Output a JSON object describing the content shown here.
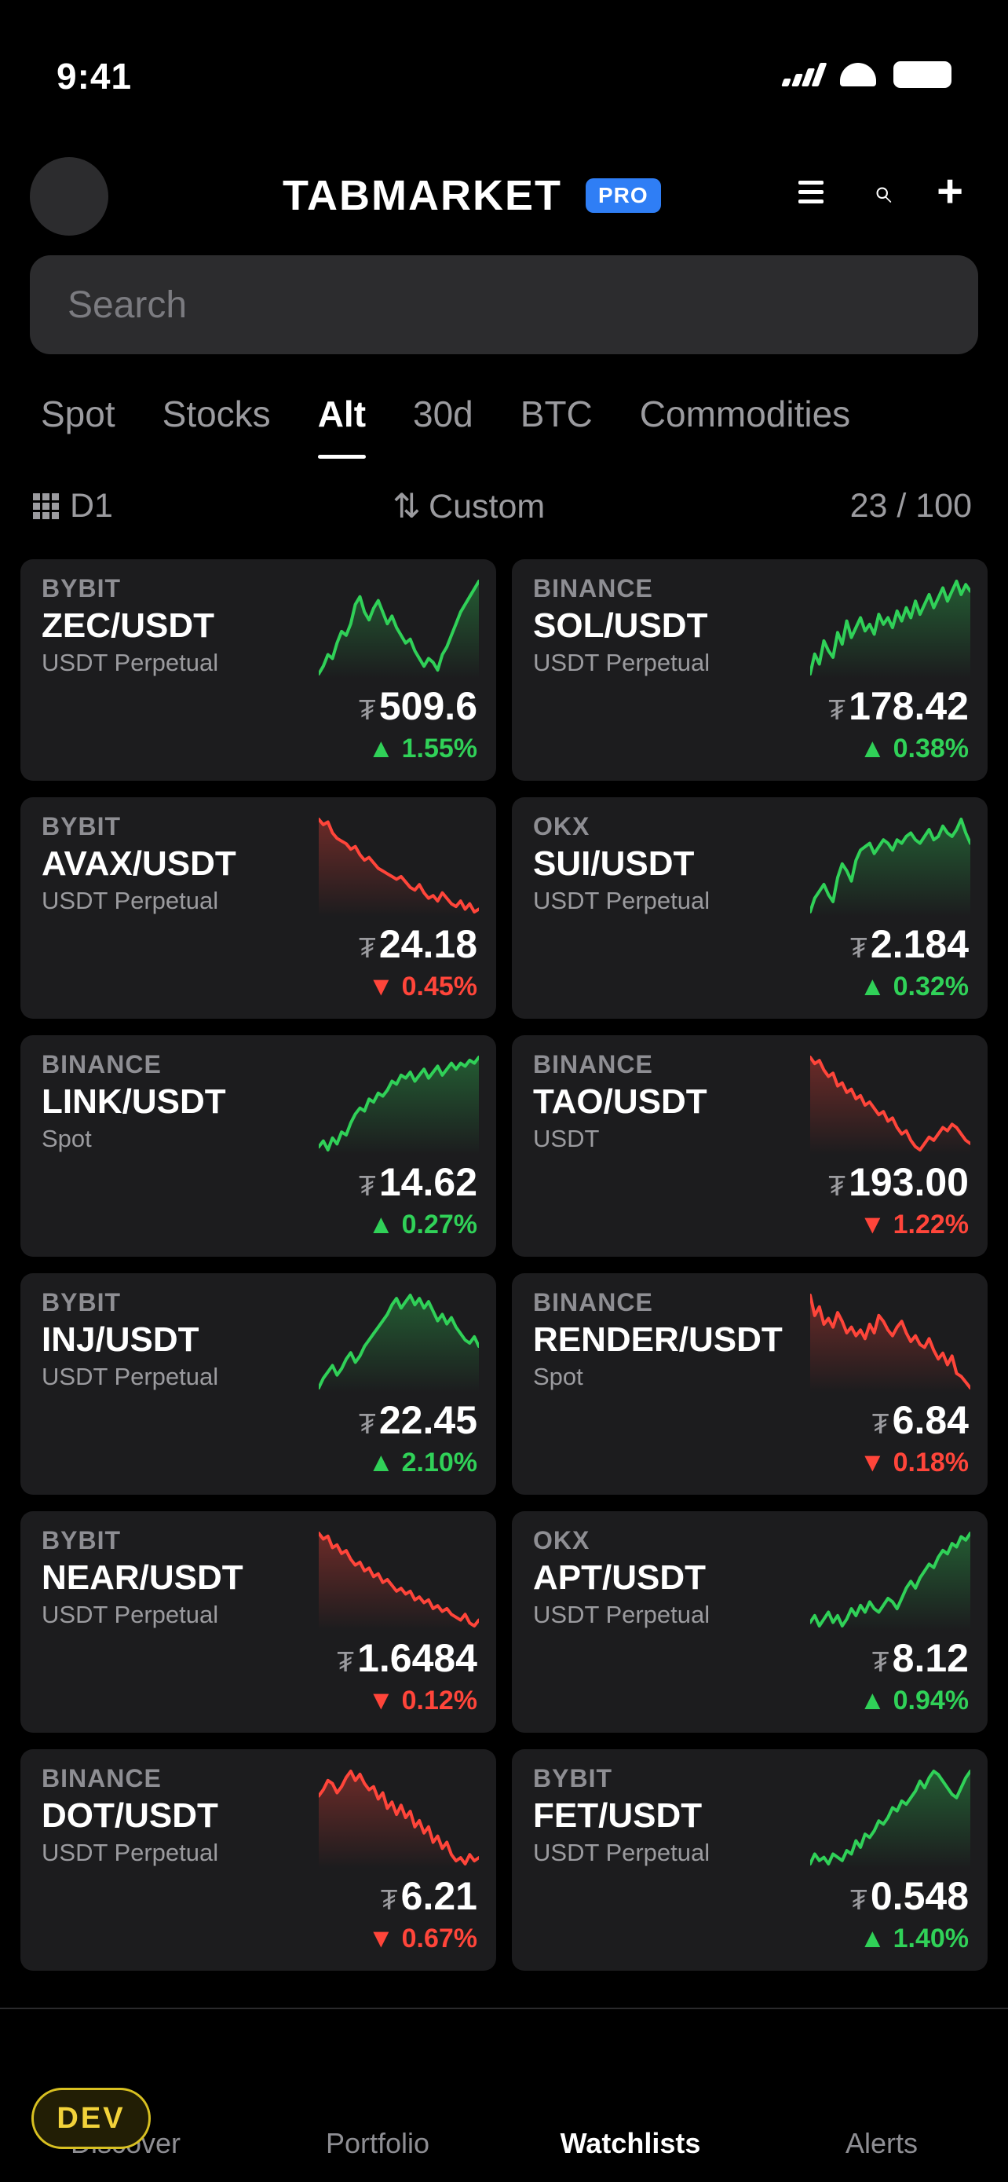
{
  "status_bar": {
    "time": "9:41"
  },
  "header": {
    "title": "TABMARKET",
    "badge": "PRO"
  },
  "search": {
    "placeholder": "Search"
  },
  "tabs": [
    {
      "label": "Spot",
      "active": false
    },
    {
      "label": "Stocks",
      "active": false
    },
    {
      "label": "Alt",
      "active": true
    },
    {
      "label": "30d",
      "active": false
    },
    {
      "label": "BTC",
      "active": false
    },
    {
      "label": "Commodities",
      "active": false
    }
  ],
  "filters": {
    "timeframe": "D1",
    "sort": "Custom",
    "count": "23 / 100"
  },
  "cards": [
    {
      "exchange": "BYBIT",
      "pair": "ZEC/USDT",
      "type": "USDT Perpetual",
      "currency": "₮",
      "price": "509.6",
      "change": "1.55%",
      "direction": "up",
      "spark": [
        42,
        44,
        47,
        46,
        50,
        53,
        52,
        55,
        60,
        62,
        58,
        56,
        59,
        61,
        58,
        55,
        57,
        54,
        52,
        50,
        51,
        48,
        46,
        44,
        46,
        45,
        43,
        47,
        49,
        52,
        55,
        58,
        60,
        62,
        64,
        66
      ]
    },
    {
      "exchange": "BINANCE",
      "pair": "SOL/USDT",
      "type": "USDT Perpetual",
      "currency": "₮",
      "price": "178.42",
      "change": "0.38%",
      "direction": "up",
      "spark": [
        30,
        42,
        36,
        50,
        44,
        40,
        55,
        48,
        62,
        52,
        58,
        64,
        56,
        60,
        54,
        66,
        60,
        64,
        58,
        68,
        62,
        70,
        64,
        74,
        66,
        72,
        78,
        70,
        76,
        82,
        74,
        80,
        86,
        78,
        84,
        80
      ]
    },
    {
      "exchange": "BYBIT",
      "pair": "AVAX/USDT",
      "type": "USDT Perpetual",
      "currency": "₮",
      "price": "24.18",
      "change": "0.45%",
      "direction": "down",
      "spark": [
        88,
        84,
        86,
        78,
        74,
        72,
        70,
        66,
        68,
        62,
        58,
        60,
        56,
        52,
        50,
        48,
        46,
        44,
        46,
        42,
        38,
        36,
        40,
        34,
        30,
        32,
        28,
        34,
        30,
        26,
        24,
        28,
        22,
        26,
        20,
        22
      ]
    },
    {
      "exchange": "OKX",
      "pair": "SUI/USDT",
      "type": "USDT Perpetual",
      "currency": "₮",
      "price": "2.184",
      "change": "0.32%",
      "direction": "up",
      "spark": [
        32,
        40,
        44,
        48,
        42,
        38,
        52,
        60,
        56,
        50,
        62,
        68,
        70,
        72,
        66,
        70,
        74,
        72,
        68,
        74,
        72,
        76,
        78,
        74,
        72,
        76,
        80,
        74,
        76,
        82,
        78,
        76,
        80,
        86,
        78,
        72
      ]
    },
    {
      "exchange": "BINANCE",
      "pair": "LINK/USDT",
      "type": "Spot",
      "currency": "₮",
      "price": "14.62",
      "change": "0.27%",
      "direction": "up",
      "spark": [
        24,
        28,
        22,
        30,
        26,
        34,
        32,
        40,
        46,
        50,
        48,
        56,
        54,
        60,
        58,
        62,
        68,
        66,
        72,
        70,
        74,
        68,
        72,
        76,
        70,
        74,
        78,
        72,
        76,
        80,
        76,
        80,
        78,
        82,
        80,
        84
      ]
    },
    {
      "exchange": "BINANCE",
      "pair": "TAO/USDT",
      "type": "USDT",
      "currency": "₮",
      "price": "193.00",
      "change": "1.22%",
      "direction": "down",
      "spark": [
        88,
        84,
        86,
        80,
        76,
        78,
        70,
        72,
        66,
        68,
        62,
        64,
        58,
        60,
        56,
        52,
        54,
        48,
        50,
        44,
        40,
        42,
        36,
        32,
        30,
        34,
        38,
        36,
        40,
        44,
        42,
        46,
        44,
        40,
        36,
        34
      ]
    },
    {
      "exchange": "BYBIT",
      "pair": "INJ/USDT",
      "type": "USDT Perpetual",
      "currency": "₮",
      "price": "22.45",
      "change": "2.10%",
      "direction": "up",
      "spark": [
        30,
        36,
        40,
        44,
        38,
        42,
        48,
        52,
        46,
        50,
        56,
        60,
        64,
        68,
        72,
        76,
        82,
        86,
        80,
        84,
        88,
        82,
        86,
        80,
        84,
        78,
        72,
        76,
        70,
        74,
        68,
        64,
        60,
        58,
        62,
        56
      ]
    },
    {
      "exchange": "BINANCE",
      "pair": "RENDER/USDT",
      "type": "Spot",
      "currency": "₮",
      "price": "6.84",
      "change": "0.18%",
      "direction": "down",
      "spark": [
        84,
        70,
        76,
        64,
        68,
        62,
        72,
        66,
        58,
        62,
        56,
        60,
        54,
        64,
        58,
        70,
        66,
        60,
        56,
        62,
        66,
        58,
        52,
        56,
        50,
        48,
        54,
        46,
        40,
        44,
        36,
        42,
        30,
        28,
        24,
        20
      ]
    },
    {
      "exchange": "BYBIT",
      "pair": "NEAR/USDT",
      "type": "USDT Perpetual",
      "currency": "₮",
      "price": "1.6484",
      "change": "0.12%",
      "direction": "down",
      "spark": [
        86,
        82,
        84,
        76,
        78,
        72,
        74,
        68,
        64,
        66,
        60,
        62,
        56,
        58,
        52,
        54,
        50,
        46,
        48,
        44,
        46,
        40,
        42,
        38,
        40,
        34,
        36,
        32,
        34,
        30,
        28,
        26,
        30,
        24,
        22,
        26
      ]
    },
    {
      "exchange": "OKX",
      "pair": "APT/USDT",
      "type": "USDT Perpetual",
      "currency": "₮",
      "price": "8.12",
      "change": "0.94%",
      "direction": "up",
      "spark": [
        30,
        34,
        28,
        32,
        36,
        30,
        34,
        28,
        32,
        38,
        34,
        40,
        36,
        42,
        38,
        36,
        40,
        44,
        42,
        38,
        44,
        50,
        54,
        50,
        56,
        60,
        64,
        62,
        68,
        72,
        70,
        76,
        74,
        80,
        78,
        82
      ]
    },
    {
      "exchange": "BINANCE",
      "pair": "DOT/USDT",
      "type": "USDT Perpetual",
      "currency": "₮",
      "price": "6.21",
      "change": "0.67%",
      "direction": "down",
      "spark": [
        70,
        74,
        80,
        78,
        72,
        76,
        82,
        86,
        80,
        84,
        78,
        74,
        76,
        68,
        72,
        62,
        66,
        58,
        64,
        56,
        60,
        50,
        54,
        46,
        50,
        40,
        44,
        36,
        40,
        32,
        28,
        30,
        26,
        32,
        28,
        30
      ]
    },
    {
      "exchange": "BYBIT",
      "pair": "FET/USDT",
      "type": "USDT Perpetual",
      "currency": "₮",
      "price": "0.548",
      "change": "1.40%",
      "direction": "up",
      "spark": [
        30,
        36,
        32,
        34,
        30,
        36,
        34,
        32,
        38,
        36,
        44,
        40,
        48,
        46,
        50,
        56,
        54,
        58,
        64,
        62,
        68,
        66,
        70,
        74,
        80,
        76,
        82,
        86,
        84,
        80,
        76,
        72,
        70,
        76,
        82,
        86
      ]
    }
  ],
  "bottom_nav": {
    "items": [
      {
        "label": "Discover",
        "active": false
      },
      {
        "label": "Portfolio",
        "active": false
      },
      {
        "label": "Watchlists",
        "active": true
      },
      {
        "label": "Alerts",
        "active": false
      }
    ],
    "dev_badge": "DEV"
  },
  "colors": {
    "up": "#30d158",
    "down": "#ff453a",
    "accent": "#2f7ef5",
    "card_bg": "#1c1c1e",
    "dev_badge": "#f2d23a"
  },
  "icons": {
    "header_right": [
      "menu-icon",
      "search-icon",
      "plus-icon"
    ],
    "filter_timeframe": "grid-icon",
    "filter_sort": "sort-arrows-icon"
  }
}
